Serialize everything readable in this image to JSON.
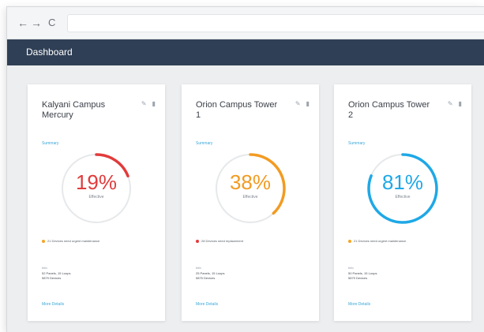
{
  "browser": {
    "back_icon": "←",
    "forward_icon": "→",
    "reload_icon": "C",
    "url": ""
  },
  "app": {
    "title": "Dashboard"
  },
  "cards": [
    {
      "title": "Kalyani Campus Mercury",
      "summary_label": "Summary",
      "percent": 19,
      "percent_label": "19%",
      "status_label": "Effective",
      "accent_color": "#e23b3b",
      "alert_color": "#f5a623",
      "alert_text": "21 Devices need urgent maintenance",
      "info_label": "Info",
      "info_line1": "52 Panels, 15 Loops",
      "info_line2": "5879 Devices",
      "more_label": "More Details"
    },
    {
      "title": "Orion Campus Tower 1",
      "summary_label": "Summary",
      "percent": 38,
      "percent_label": "38%",
      "status_label": "Effective",
      "accent_color": "#f29b22",
      "alert_color": "#e23b3b",
      "alert_text": "28 Devices need replacement",
      "info_label": "Info",
      "info_line1": "25 Panels, 15 Loops",
      "info_line2": "5875 Devices",
      "more_label": "More Details"
    },
    {
      "title": "Orion Campus Tower 2",
      "summary_label": "Summary",
      "percent": 81,
      "percent_label": "81%",
      "status_label": "Effective",
      "accent_color": "#1fa8e6",
      "alert_color": "#f5a623",
      "alert_text": "21 Devices need urgent maintenance",
      "info_label": "Info",
      "info_line1": "50 Panels, 15 Loops",
      "info_line2": "5879 Devices",
      "more_label": "More Details"
    }
  ]
}
